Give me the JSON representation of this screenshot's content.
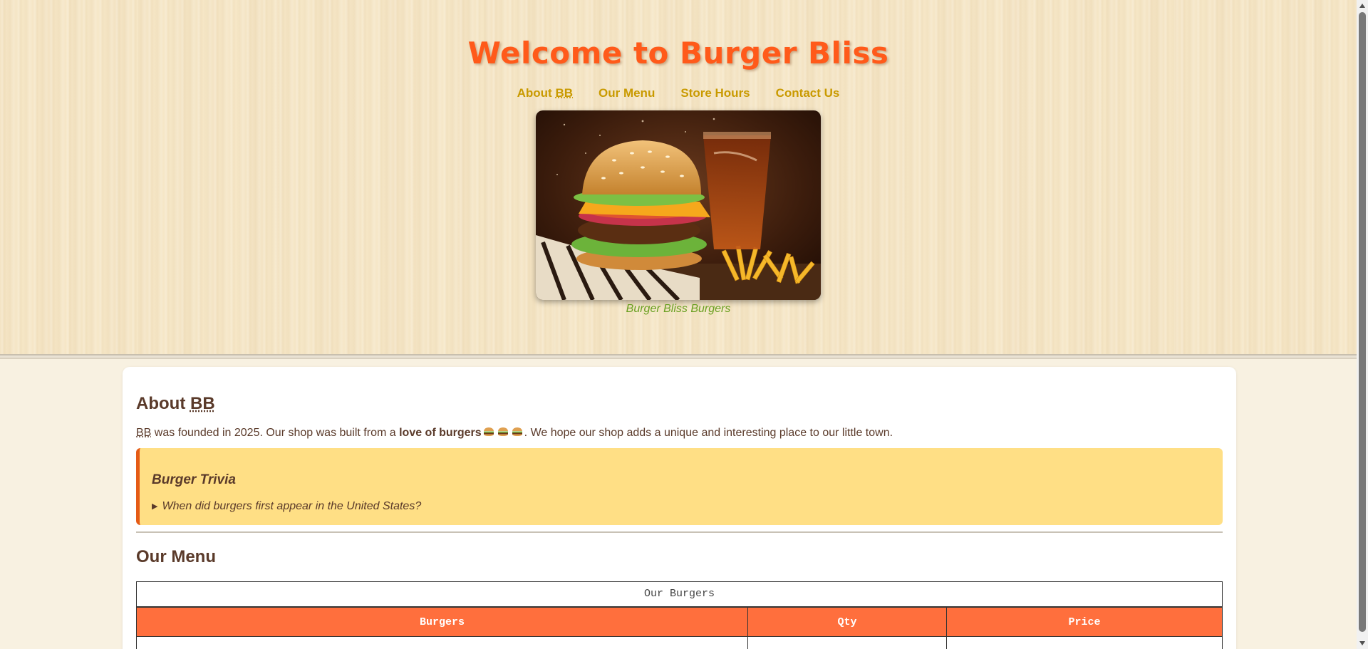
{
  "header": {
    "title": "Welcome to Burger Bliss",
    "nav": [
      {
        "label": "About ",
        "abbr": "BB"
      },
      {
        "label": "Our Menu"
      },
      {
        "label": "Store Hours"
      },
      {
        "label": "Contact Us"
      }
    ],
    "hero_caption": "Burger Bliss Burgers"
  },
  "about": {
    "heading": "About ",
    "heading_abbr": "BB",
    "text_abbr": "BB",
    "text_1": " was founded in 2025. Our shop was built from a ",
    "text_bold": "love of burgers",
    "text_2": ". We hope our shop adds a unique and interesting place to our little town.",
    "emoji": [
      "burger-icon",
      "burger-icon",
      "burger-icon"
    ]
  },
  "trivia": {
    "heading": "Burger Trivia",
    "question": "When did burgers first appear in the United States?"
  },
  "menu": {
    "heading": "Our Menu",
    "caption": "Our Burgers",
    "columns": [
      "Burgers",
      "Qty",
      "Price"
    ]
  },
  "colors": {
    "title": "#ff5a1a",
    "nav": "#c99a00",
    "caption": "#6aa022",
    "trivia_bg": "#ffdf85",
    "trivia_border": "#e55b16",
    "table_header": "#ff6f3d"
  }
}
